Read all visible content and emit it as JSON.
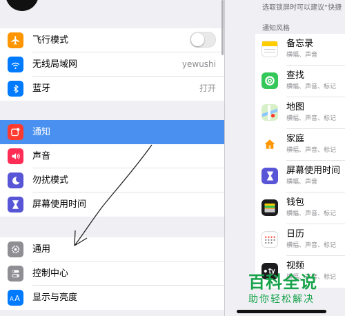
{
  "settings": {
    "group1": [
      {
        "id": "airplane",
        "label": "飞行模式",
        "icon": "airplane-icon",
        "color": "#ff9500",
        "toggle": false
      },
      {
        "id": "wifi",
        "label": "无线局域网",
        "icon": "wifi-icon",
        "color": "#007aff",
        "value": "yewushi"
      },
      {
        "id": "bluetooth",
        "label": "蓝牙",
        "icon": "bluetooth-icon",
        "color": "#007aff",
        "value": "打开"
      }
    ],
    "group2": [
      {
        "id": "notifications",
        "label": "通知",
        "icon": "notifications-icon",
        "color": "#ff3b30",
        "selected": true
      },
      {
        "id": "sounds",
        "label": "声音",
        "icon": "speaker-icon",
        "color": "#ff2d55"
      },
      {
        "id": "dnd",
        "label": "勿扰模式",
        "icon": "moon-icon",
        "color": "#5856d6"
      },
      {
        "id": "screentime",
        "label": "屏幕使用时间",
        "icon": "hourglass-icon",
        "color": "#5856d6"
      }
    ],
    "group3": [
      {
        "id": "general",
        "label": "通用",
        "icon": "gear-icon",
        "color": "#8e8e93"
      },
      {
        "id": "control",
        "label": "控制中心",
        "icon": "switches-icon",
        "color": "#8e8e93"
      },
      {
        "id": "display",
        "label": "显示与亮度",
        "icon": "text-size-icon",
        "color": "#007aff"
      }
    ]
  },
  "notifications": {
    "hint": "选取锁屏时可以建议“快捷",
    "section_title": "通知风格",
    "apps": [
      {
        "name": "备忘录",
        "sub": "横幅、声音",
        "icon": "notes-icon",
        "color": "#ffcc00"
      },
      {
        "name": "查找",
        "sub": "横幅、声音、标记",
        "icon": "find-my-icon",
        "color": "#34c759"
      },
      {
        "name": "地图",
        "sub": "横幅、声音、标记",
        "icon": "maps-icon",
        "color": "#4cd964"
      },
      {
        "name": "家庭",
        "sub": "横幅、声音、标记",
        "icon": "home-icon",
        "color": "#ff9500"
      },
      {
        "name": "屏幕使用时间",
        "sub": "横幅、声音",
        "icon": "hourglass-icon",
        "color": "#5856d6"
      },
      {
        "name": "钱包",
        "sub": "横幅、声音、标记",
        "icon": "wallet-icon",
        "color": "#1c1c1e"
      },
      {
        "name": "日历",
        "sub": "横幅、声音、标记",
        "icon": "calendar-icon",
        "color": "#ff3b30"
      },
      {
        "name": "视频",
        "sub": "横幅、声音、标记",
        "icon": "apple-tv-icon",
        "color": "#1c1c1e"
      }
    ]
  },
  "watermark": {
    "title": "百科全说",
    "subtitle": "助你轻松解决"
  }
}
